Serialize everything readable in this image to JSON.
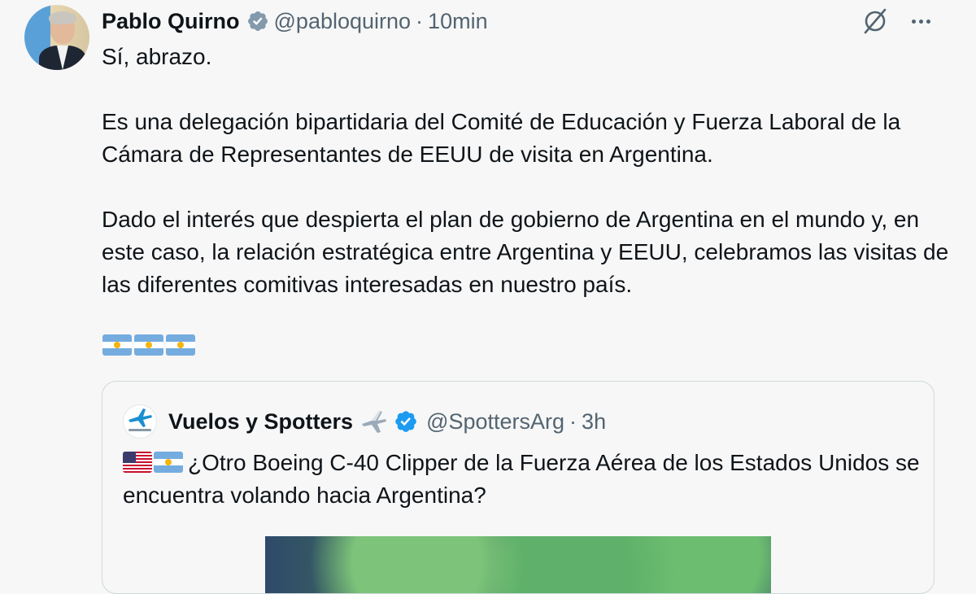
{
  "post": {
    "author_name": "Pablo Quirno",
    "handle": "@pabloquirno",
    "separator": "·",
    "time": "10min",
    "paragraphs": [
      "Sí, abrazo.",
      "Es una delegación bipartidaria del Comité de Educación y Fuerza Laboral de la Cámara de Representantes de EEUU de visita en Argentina.",
      "Dado el interés que despierta el plan de gobierno de Argentina en el mundo y, en este caso, la relación estratégica entre Argentina y EEUU, celebramos las visitas de las diferentes comitivas interesadas en nuestro país."
    ],
    "emoji_flags": [
      "argentina-flag",
      "argentina-flag",
      "argentina-flag"
    ]
  },
  "quoted": {
    "author_name": "Vuelos y Spotters",
    "handle": "@SpottersArg",
    "separator": "·",
    "time": "3h",
    "emoji_flags": [
      "usa-flag",
      "argentina-flag"
    ],
    "text": "¿Otro Boeing C-40 Clipper de la Fuerza Aérea de los Estados Unidos se encuentra volando hacia Argentina?"
  },
  "icons": {
    "verified": "verified-badge-icon",
    "grok": "grok-icon",
    "more": "more-options-icon",
    "plane": "airplane-emoji-icon"
  },
  "colors": {
    "background": "#f7f7f7",
    "text": "#0f1419",
    "secondary": "#536471",
    "verified_gray": "#829aab",
    "verified_blue": "#1d9bf0",
    "border": "#cfd9de"
  }
}
